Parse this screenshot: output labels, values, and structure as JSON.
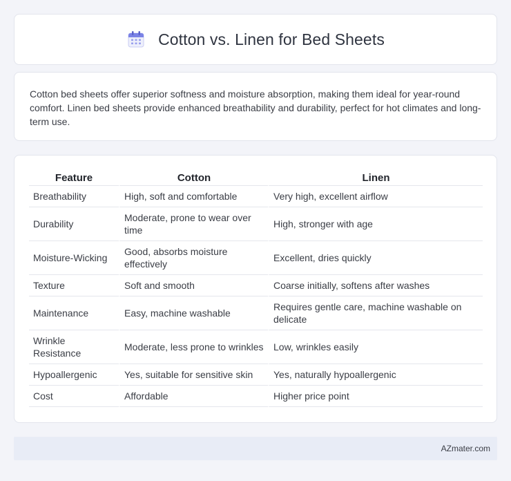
{
  "header": {
    "title": "Cotton vs. Linen for Bed Sheets",
    "icon": "calendar-icon"
  },
  "summary": {
    "text": "Cotton bed sheets offer superior softness and moisture absorption, making them ideal for year-round comfort. Linen bed sheets provide enhanced breathability and durability, perfect for hot climates and long-term use."
  },
  "table": {
    "headers": [
      "Feature",
      "Cotton",
      "Linen"
    ],
    "rows": [
      [
        "Breathability",
        "High, soft and comfortable",
        "Very high, excellent airflow"
      ],
      [
        "Durability",
        "Moderate, prone to wear over time",
        "High, stronger with age"
      ],
      [
        "Moisture-Wicking",
        "Good, absorbs moisture effectively",
        "Excellent, dries quickly"
      ],
      [
        "Texture",
        "Soft and smooth",
        "Coarse initially, softens after washes"
      ],
      [
        "Maintenance",
        "Easy, machine washable",
        "Requires gentle care, machine washable on delicate"
      ],
      [
        "Wrinkle Resistance",
        "Moderate, less prone to wrinkles",
        "Low, wrinkles easily"
      ],
      [
        "Hypoallergenic",
        "Yes, suitable for sensitive skin",
        "Yes, naturally hypoallergenic"
      ],
      [
        "Cost",
        "Affordable",
        "Higher price point"
      ]
    ]
  },
  "footer": {
    "text": "AZmater.com"
  },
  "colors": {
    "background": "#f3f4f9",
    "card": "#ffffff",
    "footer": "#e8ecf6",
    "icon_accent": "#7b83e6"
  }
}
